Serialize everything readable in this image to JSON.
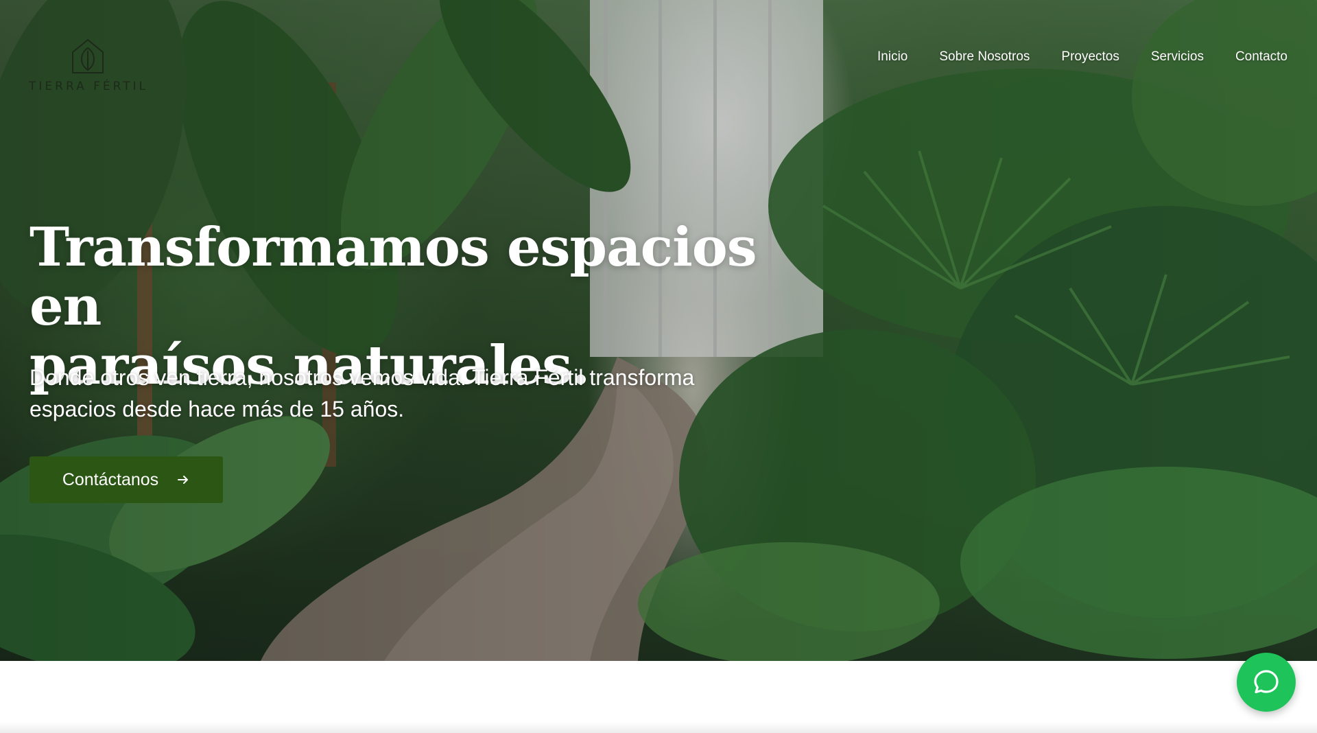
{
  "brand": {
    "name": "TIERRA FÉRTIL",
    "logo_icon": "leaf-house-icon"
  },
  "nav": {
    "items": [
      {
        "label": "Inicio"
      },
      {
        "label": "Sobre Nosotros"
      },
      {
        "label": "Proyectos"
      },
      {
        "label": "Servicios"
      },
      {
        "label": "Contacto"
      }
    ]
  },
  "hero": {
    "title_line1": "Transformamos espacios en",
    "title_line2": "paraísos naturales.",
    "subtitle_line1": "Donde otros ven tierra, nosotros vemos vida. Tierra Fértil transforma",
    "subtitle_line2": "espacios desde hace más de 15 años.",
    "cta_label": "Contáctanos",
    "cta_icon": "arrow-right-icon"
  },
  "chat": {
    "icon": "chat-bubble-icon",
    "color": "#1ec45a"
  },
  "colors": {
    "cta": "#2b5614",
    "nav_text": "#ffffff"
  }
}
